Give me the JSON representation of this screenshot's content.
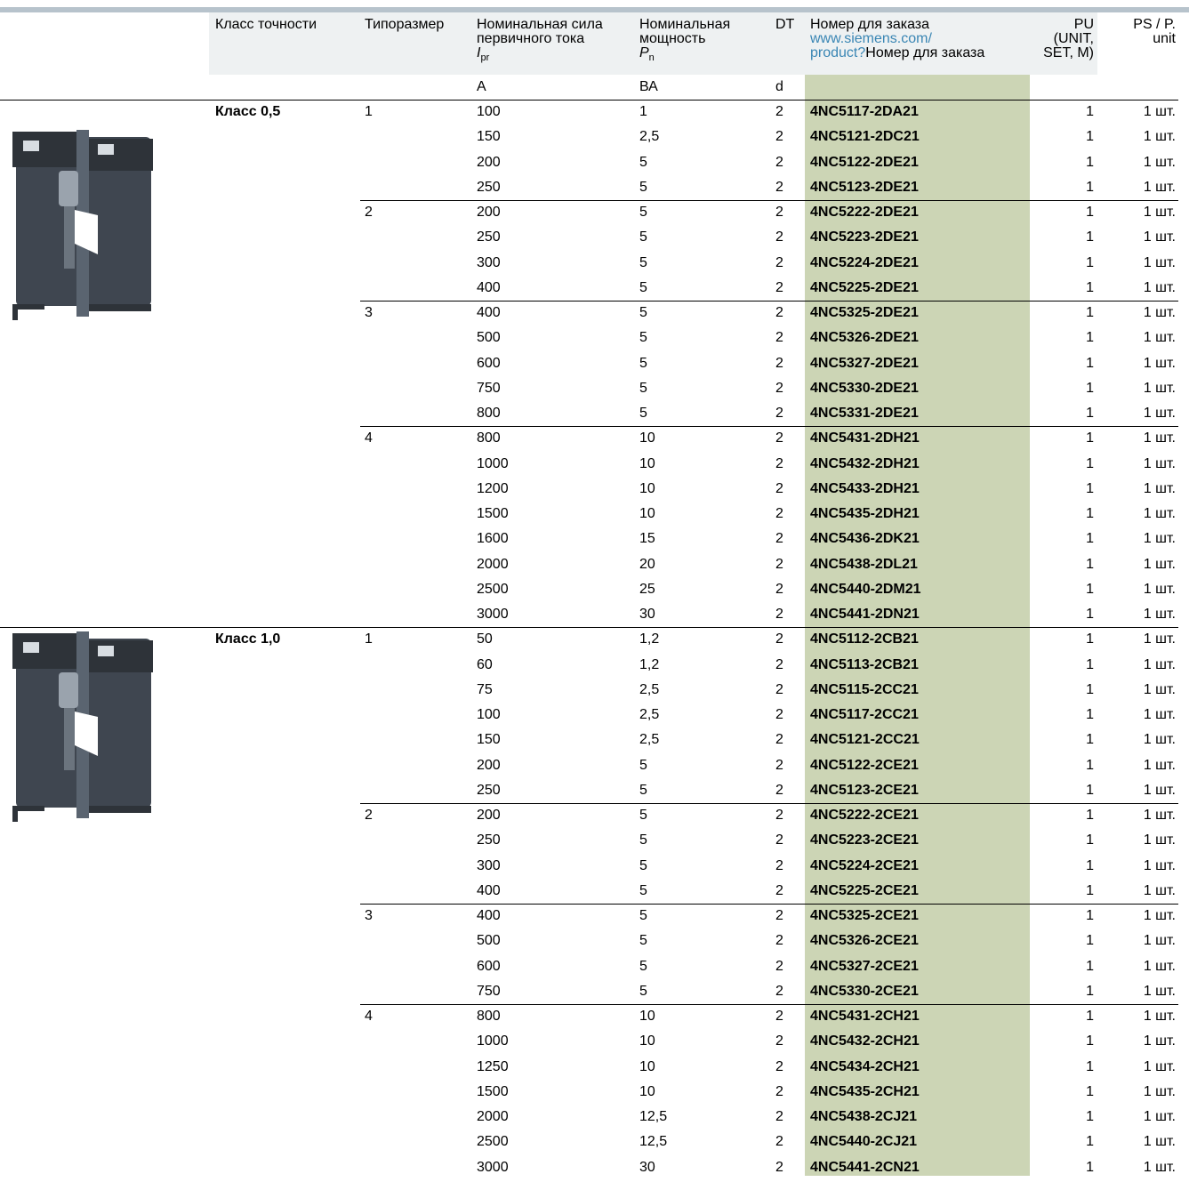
{
  "header": {
    "accuracy_class": "Класс точности",
    "frame_size": "Типоразмер",
    "rated_current_l1": "Номинальная сила",
    "rated_current_l2": "первичного тока",
    "rated_current_sym": "I",
    "rated_current_sub": "pr",
    "rated_power_l1": "Номинальная",
    "rated_power_l2": "мощность",
    "rated_power_sym": "P",
    "rated_power_sub": "n",
    "dt": "DT",
    "order_l1": "Номер для заказа",
    "order_link_l1": "www.siemens.com/",
    "order_link_l2": "product?",
    "order_l2": "Номер для заказа",
    "pu_l1": "PU",
    "pu_l2": "(UNIT,",
    "pu_l3": "SET, M)",
    "ps_l1": "PS / P.",
    "ps_l2": "unit"
  },
  "units": {
    "current": "A",
    "power": "ВА",
    "dt": "d"
  },
  "rows": [
    {
      "cls": "Класс 0,5",
      "size": "1",
      "cur": "100",
      "pow": "1",
      "dt": "2",
      "ord": "4NC5117-2DA21",
      "pu": "1",
      "ps": "1 шт.",
      "line": true
    },
    {
      "cls": "",
      "size": "",
      "cur": "150",
      "pow": "2,5",
      "dt": "2",
      "ord": "4NC5121-2DC21",
      "pu": "1",
      "ps": "1 шт."
    },
    {
      "cls": "",
      "size": "",
      "cur": "200",
      "pow": "5",
      "dt": "2",
      "ord": "4NC5122-2DE21",
      "pu": "1",
      "ps": "1 шт."
    },
    {
      "cls": "",
      "size": "",
      "cur": "250",
      "pow": "5",
      "dt": "2",
      "ord": "4NC5123-2DE21",
      "pu": "1",
      "ps": "1 шт."
    },
    {
      "cls": "",
      "size": "2",
      "cur": "200",
      "pow": "5",
      "dt": "2",
      "ord": "4NC5222-2DE21",
      "pu": "1",
      "ps": "1 шт.",
      "sep": true
    },
    {
      "cls": "",
      "size": "",
      "cur": "250",
      "pow": "5",
      "dt": "2",
      "ord": "4NC5223-2DE21",
      "pu": "1",
      "ps": "1 шт."
    },
    {
      "cls": "",
      "size": "",
      "cur": "300",
      "pow": "5",
      "dt": "2",
      "ord": "4NC5224-2DE21",
      "pu": "1",
      "ps": "1 шт."
    },
    {
      "cls": "",
      "size": "",
      "cur": "400",
      "pow": "5",
      "dt": "2",
      "ord": "4NC5225-2DE21",
      "pu": "1",
      "ps": "1 шт."
    },
    {
      "cls": "",
      "size": "3",
      "cur": "400",
      "pow": "5",
      "dt": "2",
      "ord": "4NC5325-2DE21",
      "pu": "1",
      "ps": "1 шт.",
      "sep": true
    },
    {
      "cls": "",
      "size": "",
      "cur": "500",
      "pow": "5",
      "dt": "2",
      "ord": "4NC5326-2DE21",
      "pu": "1",
      "ps": "1 шт."
    },
    {
      "cls": "",
      "size": "",
      "cur": "600",
      "pow": "5",
      "dt": "2",
      "ord": "4NC5327-2DE21",
      "pu": "1",
      "ps": "1 шт."
    },
    {
      "cls": "",
      "size": "",
      "cur": "750",
      "pow": "5",
      "dt": "2",
      "ord": "4NC5330-2DE21",
      "pu": "1",
      "ps": "1 шт."
    },
    {
      "cls": "",
      "size": "",
      "cur": "800",
      "pow": "5",
      "dt": "2",
      "ord": "4NC5331-2DE21",
      "pu": "1",
      "ps": "1 шт."
    },
    {
      "cls": "",
      "size": "4",
      "cur": "800",
      "pow": "10",
      "dt": "2",
      "ord": "4NC5431-2DH21",
      "pu": "1",
      "ps": "1 шт.",
      "sep": true
    },
    {
      "cls": "",
      "size": "",
      "cur": "1000",
      "pow": "10",
      "dt": "2",
      "ord": "4NC5432-2DH21",
      "pu": "1",
      "ps": "1 шт."
    },
    {
      "cls": "",
      "size": "",
      "cur": "1200",
      "pow": "10",
      "dt": "2",
      "ord": "4NC5433-2DH21",
      "pu": "1",
      "ps": "1 шт."
    },
    {
      "cls": "",
      "size": "",
      "cur": "1500",
      "pow": "10",
      "dt": "2",
      "ord": "4NC5435-2DH21",
      "pu": "1",
      "ps": "1 шт."
    },
    {
      "cls": "",
      "size": "",
      "cur": "1600",
      "pow": "15",
      "dt": "2",
      "ord": "4NC5436-2DK21",
      "pu": "1",
      "ps": "1 шт."
    },
    {
      "cls": "",
      "size": "",
      "cur": "2000",
      "pow": "20",
      "dt": "2",
      "ord": "4NC5438-2DL21",
      "pu": "1",
      "ps": "1 шт."
    },
    {
      "cls": "",
      "size": "",
      "cur": "2500",
      "pow": "25",
      "dt": "2",
      "ord": "4NC5440-2DM21",
      "pu": "1",
      "ps": "1 шт."
    },
    {
      "cls": "",
      "size": "",
      "cur": "3000",
      "pow": "30",
      "dt": "2",
      "ord": "4NC5441-2DN21",
      "pu": "1",
      "ps": "1 шт."
    },
    {
      "cls": "Класс 1,0",
      "size": "1",
      "cur": "50",
      "pow": "1,2",
      "dt": "2",
      "ord": "4NC5112-2CB21",
      "pu": "1",
      "ps": "1 шт.",
      "line": true
    },
    {
      "cls": "",
      "size": "",
      "cur": "60",
      "pow": "1,2",
      "dt": "2",
      "ord": "4NC5113-2CB21",
      "pu": "1",
      "ps": "1 шт."
    },
    {
      "cls": "",
      "size": "",
      "cur": "75",
      "pow": "2,5",
      "dt": "2",
      "ord": "4NC5115-2CC21",
      "pu": "1",
      "ps": "1 шт."
    },
    {
      "cls": "",
      "size": "",
      "cur": "100",
      "pow": "2,5",
      "dt": "2",
      "ord": "4NC5117-2CC21",
      "pu": "1",
      "ps": "1 шт."
    },
    {
      "cls": "",
      "size": "",
      "cur": "150",
      "pow": "2,5",
      "dt": "2",
      "ord": "4NC5121-2CC21",
      "pu": "1",
      "ps": "1 шт."
    },
    {
      "cls": "",
      "size": "",
      "cur": "200",
      "pow": "5",
      "dt": "2",
      "ord": "4NC5122-2CE21",
      "pu": "1",
      "ps": "1 шт."
    },
    {
      "cls": "",
      "size": "",
      "cur": "250",
      "pow": "5",
      "dt": "2",
      "ord": "4NC5123-2CE21",
      "pu": "1",
      "ps": "1 шт."
    },
    {
      "cls": "",
      "size": "2",
      "cur": "200",
      "pow": "5",
      "dt": "2",
      "ord": "4NC5222-2CE21",
      "pu": "1",
      "ps": "1 шт.",
      "sep": true
    },
    {
      "cls": "",
      "size": "",
      "cur": "250",
      "pow": "5",
      "dt": "2",
      "ord": "4NC5223-2CE21",
      "pu": "1",
      "ps": "1 шт."
    },
    {
      "cls": "",
      "size": "",
      "cur": "300",
      "pow": "5",
      "dt": "2",
      "ord": "4NC5224-2CE21",
      "pu": "1",
      "ps": "1 шт."
    },
    {
      "cls": "",
      "size": "",
      "cur": "400",
      "pow": "5",
      "dt": "2",
      "ord": "4NC5225-2CE21",
      "pu": "1",
      "ps": "1 шт."
    },
    {
      "cls": "",
      "size": "3",
      "cur": "400",
      "pow": "5",
      "dt": "2",
      "ord": "4NC5325-2CE21",
      "pu": "1",
      "ps": "1 шт.",
      "sep": true
    },
    {
      "cls": "",
      "size": "",
      "cur": "500",
      "pow": "5",
      "dt": "2",
      "ord": "4NC5326-2CE21",
      "pu": "1",
      "ps": "1 шт."
    },
    {
      "cls": "",
      "size": "",
      "cur": "600",
      "pow": "5",
      "dt": "2",
      "ord": "4NC5327-2CE21",
      "pu": "1",
      "ps": "1 шт."
    },
    {
      "cls": "",
      "size": "",
      "cur": "750",
      "pow": "5",
      "dt": "2",
      "ord": "4NC5330-2CE21",
      "pu": "1",
      "ps": "1 шт."
    },
    {
      "cls": "",
      "size": "4",
      "cur": "800",
      "pow": "10",
      "dt": "2",
      "ord": "4NC5431-2CH21",
      "pu": "1",
      "ps": "1 шт.",
      "sep": true
    },
    {
      "cls": "",
      "size": "",
      "cur": "1000",
      "pow": "10",
      "dt": "2",
      "ord": "4NC5432-2CH21",
      "pu": "1",
      "ps": "1 шт."
    },
    {
      "cls": "",
      "size": "",
      "cur": "1250",
      "pow": "10",
      "dt": "2",
      "ord": "4NC5434-2CH21",
      "pu": "1",
      "ps": "1 шт."
    },
    {
      "cls": "",
      "size": "",
      "cur": "1500",
      "pow": "10",
      "dt": "2",
      "ord": "4NC5435-2CH21",
      "pu": "1",
      "ps": "1 шт."
    },
    {
      "cls": "",
      "size": "",
      "cur": "2000",
      "pow": "12,5",
      "dt": "2",
      "ord": "4NC5438-2CJ21",
      "pu": "1",
      "ps": "1 шт."
    },
    {
      "cls": "",
      "size": "",
      "cur": "2500",
      "pow": "12,5",
      "dt": "2",
      "ord": "4NC5440-2CJ21",
      "pu": "1",
      "ps": "1 шт."
    },
    {
      "cls": "",
      "size": "",
      "cur": "3000",
      "pow": "30",
      "dt": "2",
      "ord": "4NC5441-2CN21",
      "pu": "1",
      "ps": "1 шт."
    }
  ],
  "colors": {
    "order_column_bg": "#ccd5b5",
    "header_bg": "#eef1f2",
    "link": "#3a86b4",
    "top_bar": "#b7c3cc"
  },
  "images": [
    "current-transformer-product-photo",
    "current-transformer-product-photo"
  ]
}
